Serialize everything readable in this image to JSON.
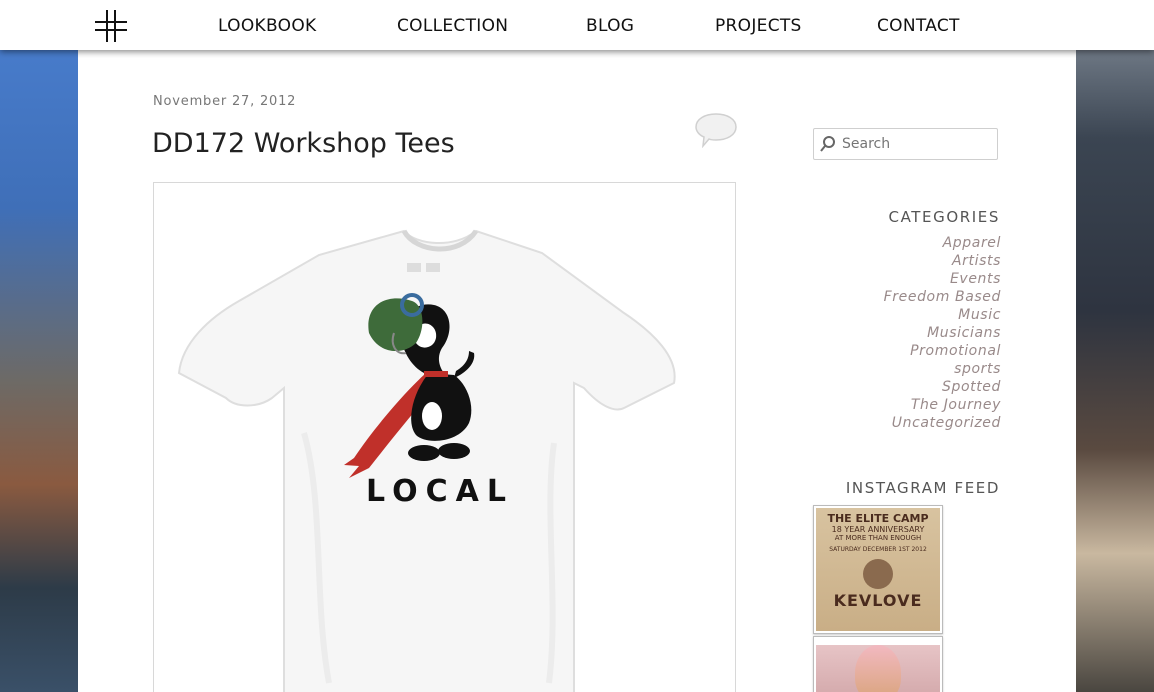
{
  "nav": {
    "items": [
      "LOOKBOOK",
      "COLLECTION",
      "BLOG",
      "PROJECTS",
      "CONTACT"
    ]
  },
  "post": {
    "date": "November 27, 2012",
    "title": "DD172 Workshop Tees",
    "shirt_text": "LOCAL"
  },
  "sidebar": {
    "search_placeholder": "Search",
    "categories_title": "CATEGORIES",
    "categories": [
      "Apparel",
      "Artists",
      "Events",
      "Freedom Based",
      "Music",
      "Musicians",
      "Promotional",
      "sports",
      "Spotted",
      "The Journey",
      "Uncategorized"
    ],
    "instagram_title": "INSTAGRAM FEED",
    "insta_1": {
      "line1": "THE ELITE CAMP",
      "line2": "18 YEAR ANNIVERSARY",
      "line3": "AT MORE THAN ENOUGH",
      "line4": "SATURDAY DECEMBER 1ST 2012",
      "headline": "KEVLOVE"
    }
  },
  "colors": {
    "nav_text": "#111111",
    "category_text": "#998a8a",
    "scarf_red": "#c0302a",
    "helmet_green": "#3e6b3a"
  }
}
